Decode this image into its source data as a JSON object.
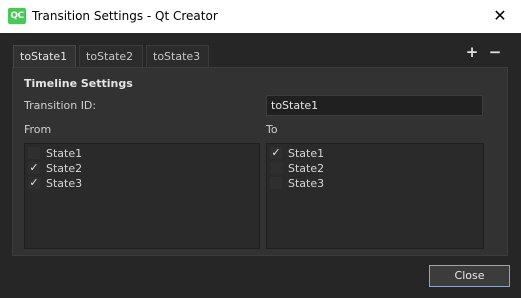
{
  "window": {
    "title": "Transition Settings - Qt Creator",
    "app_icon_text": "QC",
    "close_glyph": "✕"
  },
  "tabs": [
    {
      "label": "toState1",
      "active": true
    },
    {
      "label": "toState2",
      "active": false
    },
    {
      "label": "toState3",
      "active": false
    }
  ],
  "tab_actions": {
    "add": "+",
    "remove": "−"
  },
  "settings": {
    "section_title": "Timeline Settings",
    "transition_id_label": "Transition ID:",
    "transition_id_value": "toState1",
    "from_label": "From",
    "to_label": "To"
  },
  "from_states": [
    {
      "label": "State1",
      "checked": false
    },
    {
      "label": "State2",
      "checked": true
    },
    {
      "label": "State3",
      "checked": true
    }
  ],
  "to_states": [
    {
      "label": "State1",
      "checked": true
    },
    {
      "label": "State2",
      "checked": false
    },
    {
      "label": "State3",
      "checked": false
    }
  ],
  "buttons": {
    "close": "Close"
  },
  "check_glyph": "✓"
}
